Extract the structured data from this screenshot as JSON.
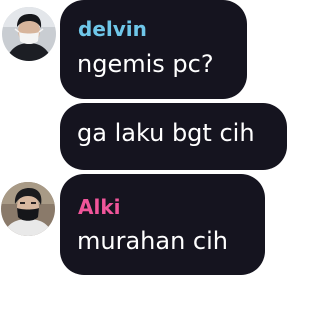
{
  "conversation": {
    "messages": [
      {
        "sender": "delvin",
        "sender_color": "#6fc7e9",
        "text": "ngemis pc?",
        "avatar_icon": "user-avatar-masked-person"
      },
      {
        "sender": "",
        "text": "ga laku bgt cih"
      },
      {
        "sender": "Alki",
        "sender_color": "#f0559a",
        "text": "murahan cih",
        "avatar_icon": "user-avatar-masked-person"
      }
    ]
  },
  "colors": {
    "bubble_background": "#15141f",
    "message_text": "#ffffff",
    "page_background": "#ffffff"
  }
}
